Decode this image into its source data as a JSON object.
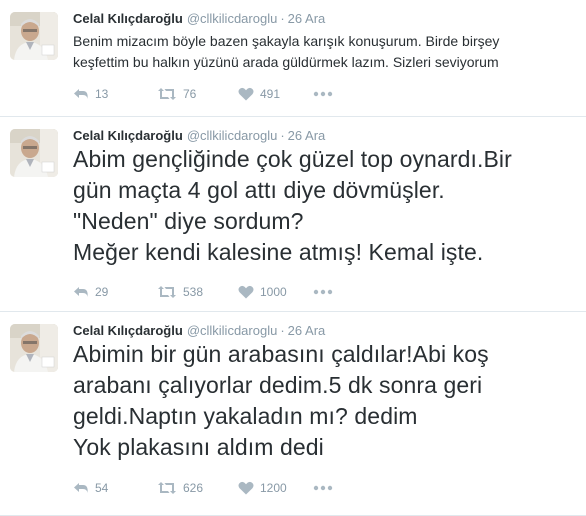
{
  "tweets": [
    {
      "name": "Celal Kılıçdaroğlu",
      "handle": "@cllkilicdaroglu",
      "separator": "·",
      "time": "26 Ara",
      "text": "Benim mizacım böyle bazen şakayla karışık konuşurum. Birde birşey\nkeşfettim bu halkın yüzünü arada güldürmek lazım.  Sizleri seviyorum",
      "replies": "13",
      "retweets": "76",
      "likes": "491"
    },
    {
      "name": "Celal Kılıçdaroğlu",
      "handle": "@cllkilicdaroglu",
      "separator": "·",
      "time": "26 Ara",
      "text": "Abim gençliğinde çok güzel top oynardı.Bir\ngün maçta 4 gol attı diye dövmüşler.\n\"Neden\" diye sordum?\nMeğer kendi kalesine atmış! Kemal işte.",
      "replies": "29",
      "retweets": "538",
      "likes": "1000"
    },
    {
      "name": "Celal Kılıçdaroğlu",
      "handle": "@cllkilicdaroglu",
      "separator": "·",
      "time": "26 Ara",
      "text": "Abimin bir gün arabasını çaldılar!Abi koş\narabanı çalıyorlar dedim.5 dk sonra geri\ngeldi.Naptın yakaladın mı? dedim\nYok plakasını aldım dedi",
      "replies": "54",
      "retweets": "626",
      "likes": "1200"
    }
  ],
  "icons": {
    "reply": "reply-icon",
    "retweet": "retweet-icon",
    "like": "heart-icon",
    "more": "more-icon"
  },
  "colors": {
    "text": "#292f33",
    "muted": "#8899a6",
    "action_icon": "#aab8c2",
    "divider": "#e1e8ed"
  }
}
